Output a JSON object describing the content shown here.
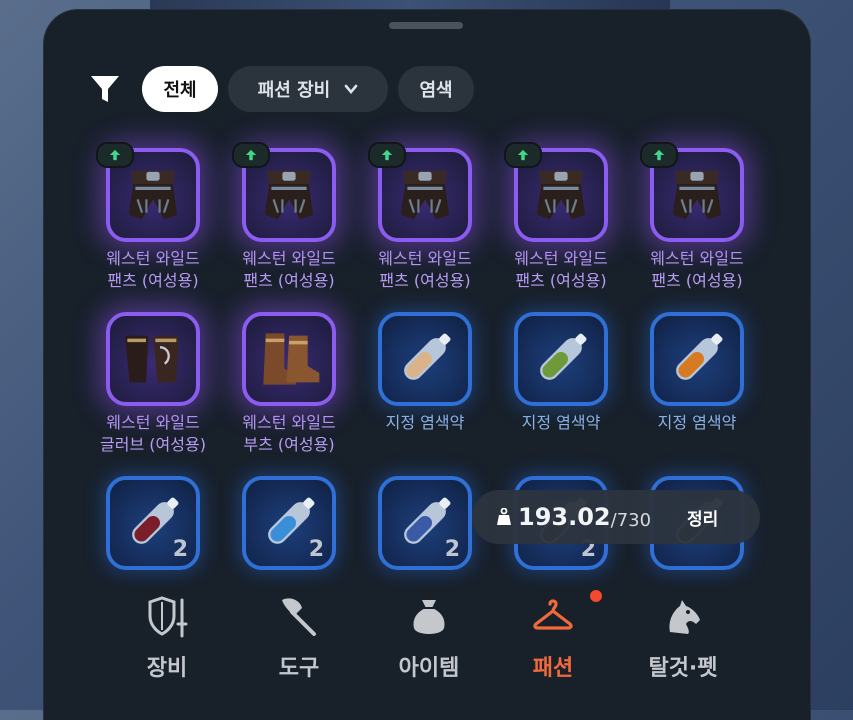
{
  "filter": {
    "icon": "filter-icon",
    "chips": [
      {
        "label": "전체",
        "active": true
      },
      {
        "label": "패션 장비",
        "dropdown": true
      },
      {
        "label": "염색"
      }
    ]
  },
  "items": [
    {
      "name1": "웨스턴 와일드",
      "name2": "팬츠 (여성용)",
      "rarity": "purple",
      "icon": "pants-icon",
      "badge": "up-arrow-badge"
    },
    {
      "name1": "웨스턴 와일드",
      "name2": "팬츠 (여성용)",
      "rarity": "purple",
      "icon": "pants-icon",
      "badge": "up-arrow-badge"
    },
    {
      "name1": "웨스턴 와일드",
      "name2": "팬츠 (여성용)",
      "rarity": "purple",
      "icon": "pants-icon",
      "badge": "up-arrow-badge"
    },
    {
      "name1": "웨스턴 와일드",
      "name2": "팬츠 (여성용)",
      "rarity": "purple",
      "icon": "pants-icon",
      "badge": "up-arrow-badge"
    },
    {
      "name1": "웨스턴 와일드",
      "name2": "팬츠 (여성용)",
      "rarity": "purple",
      "icon": "pants-icon",
      "badge": "up-arrow-badge"
    },
    {
      "name1": "웨스턴 와일드",
      "name2": "글러브 (여성용)",
      "rarity": "purple",
      "icon": "gloves-icon"
    },
    {
      "name1": "웨스턴 와일드",
      "name2": "부츠 (여성용)",
      "rarity": "purple",
      "icon": "boots-icon"
    },
    {
      "name1": "지정 염색약",
      "name2": "",
      "rarity": "blue",
      "icon": "dye-vial-icon",
      "color": "#d9b48a"
    },
    {
      "name1": "지정 염색약",
      "name2": "",
      "rarity": "blue",
      "icon": "dye-vial-icon",
      "color": "#6f9a3a"
    },
    {
      "name1": "지정 염색약",
      "name2": "",
      "rarity": "blue",
      "icon": "dye-vial-icon",
      "color": "#d77a22"
    },
    {
      "name1": "",
      "name2": "",
      "rarity": "blue",
      "icon": "dye-vial-icon",
      "color": "#7a1f2a",
      "count": "2"
    },
    {
      "name1": "",
      "name2": "",
      "rarity": "blue",
      "icon": "dye-vial-icon",
      "color": "#3a8fd8",
      "count": "2"
    },
    {
      "name1": "",
      "name2": "",
      "rarity": "blue",
      "icon": "dye-vial-icon",
      "color": "#3a5aa8",
      "count": "2"
    },
    {
      "name1": "",
      "name2": "",
      "rarity": "blue",
      "icon": "dye-vial-icon",
      "color": "#5a2a2a",
      "count": "2"
    },
    {
      "name1": "",
      "name2": "",
      "rarity": "blue",
      "icon": "dye-vial-icon",
      "color": "#2a2a2a",
      "count": ""
    }
  ],
  "weight": {
    "current": "193.02",
    "max": "/730",
    "sort_label": "정리",
    "icon": "weight-bag-icon"
  },
  "nav": {
    "tabs": [
      {
        "label": "장비",
        "icon": "shield-sword-icon"
      },
      {
        "label": "도구",
        "icon": "axe-icon"
      },
      {
        "label": "아이템",
        "icon": "pouch-icon"
      },
      {
        "label": "패션",
        "icon": "hanger-icon",
        "active": true,
        "notification": true
      },
      {
        "label": "탈것·펫",
        "icon": "horse-icon"
      }
    ]
  },
  "colors": {
    "accent": "#f06a3c",
    "rare_purple": "#8c5cf0",
    "uncommon_blue": "#2f6fd6",
    "notification": "#f24a2a"
  }
}
